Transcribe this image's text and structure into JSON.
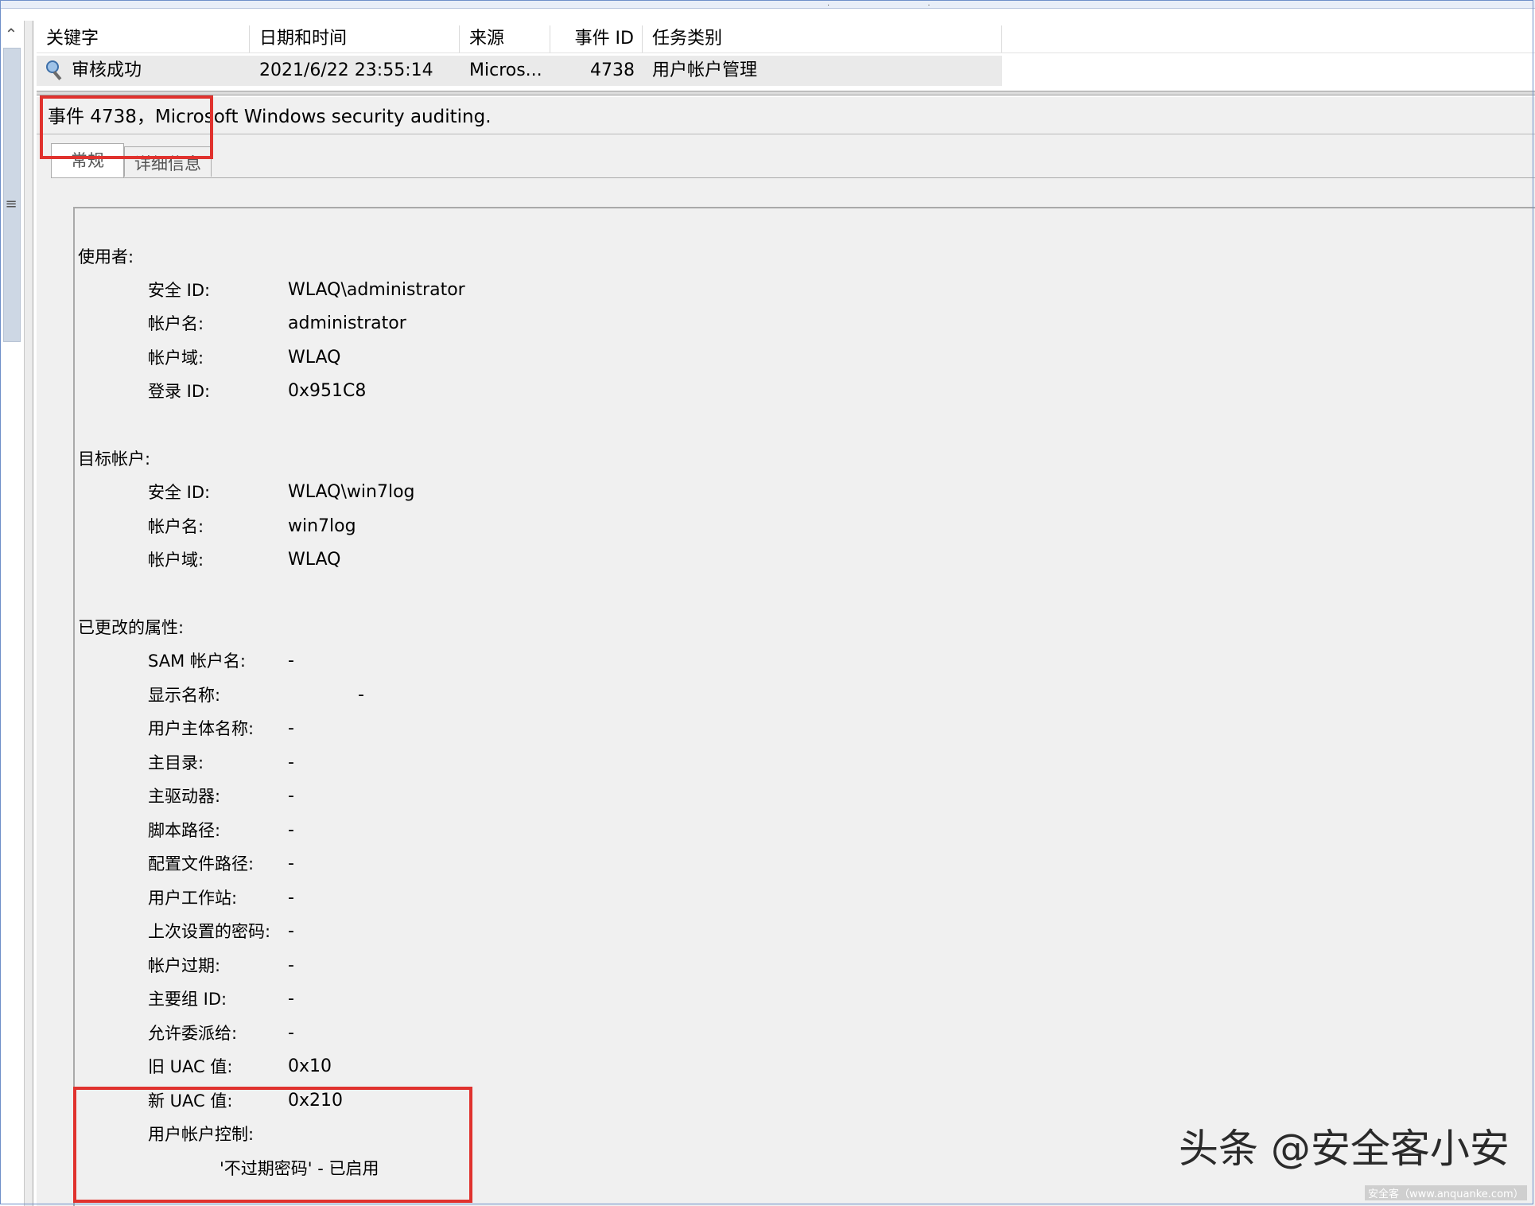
{
  "list": {
    "columns": [
      "关键字",
      "日期和时间",
      "来源",
      "事件 ID",
      "任务类别"
    ],
    "row": {
      "keyword": "审核成功",
      "datetime": "2021/6/22 23:55:14",
      "source": "Micros...",
      "event_id": "4738",
      "category": "用户帐户管理"
    }
  },
  "detail": {
    "title": "事件 4738，Microsoft Windows security auditing.",
    "tabs": [
      "常规",
      "详细信息"
    ],
    "subject": {
      "header": "使用者:",
      "fields": [
        {
          "label": "安全 ID:",
          "value": "WLAQ\\administrator"
        },
        {
          "label": "帐户名:",
          "value": "administrator"
        },
        {
          "label": "帐户域:",
          "value": "WLAQ"
        },
        {
          "label": "登录 ID:",
          "value": "0x951C8"
        }
      ]
    },
    "target": {
      "header": "目标帐户:",
      "fields": [
        {
          "label": "安全 ID:",
          "value": "WLAQ\\win7log"
        },
        {
          "label": "帐户名:",
          "value": "win7log"
        },
        {
          "label": "帐户域:",
          "value": "WLAQ"
        }
      ]
    },
    "changed": {
      "header": "已更改的属性:",
      "fields": [
        {
          "label": "SAM 帐户名:",
          "value": "-"
        },
        {
          "label": "显示名称:",
          "value": "-"
        },
        {
          "label": "用户主体名称:",
          "value": "-"
        },
        {
          "label": "主目录:",
          "value": "-"
        },
        {
          "label": "主驱动器:",
          "value": "-"
        },
        {
          "label": "脚本路径:",
          "value": "-"
        },
        {
          "label": "配置文件路径:",
          "value": "-"
        },
        {
          "label": "用户工作站:",
          "value": "-"
        },
        {
          "label": "上次设置的密码:",
          "value": "-"
        },
        {
          "label": "帐户过期:",
          "value": "-"
        },
        {
          "label": "主要组 ID:",
          "value": "-"
        },
        {
          "label": "允许委派给:",
          "value": "-"
        },
        {
          "label": "旧 UAC 值:",
          "value": "0x10"
        },
        {
          "label": "新 UAC 值:",
          "value": "0x210"
        },
        {
          "label": "用户帐户控制:",
          "value": ""
        }
      ],
      "uac_flag": "'不过期密码' - 已启用"
    }
  },
  "watermark": {
    "main": "头条 @安全客小安",
    "small": "安全客（www.anquanke.com）"
  },
  "colors": {
    "highlight_box": "#e0322e",
    "selected_row": "#eaeaea",
    "pane_background": "#f0f0f0"
  }
}
